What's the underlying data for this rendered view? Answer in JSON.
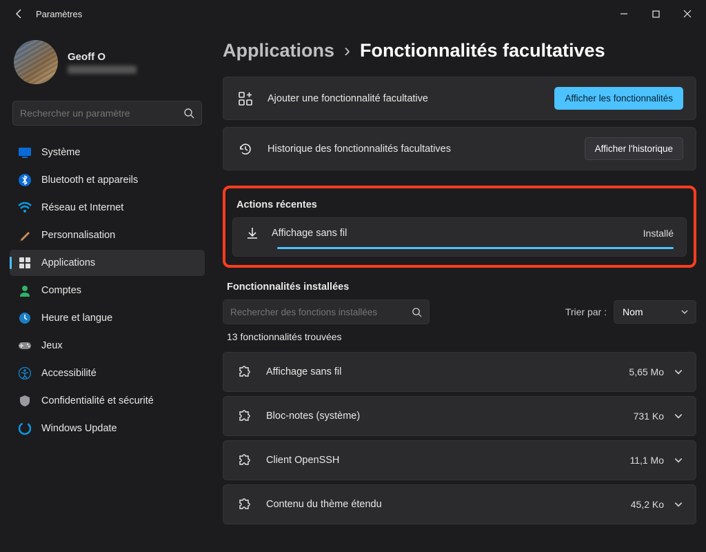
{
  "titlebar": {
    "title": "Paramètres"
  },
  "profile": {
    "name": "Geoff O"
  },
  "search": {
    "placeholder": "Rechercher un paramètre"
  },
  "nav": [
    {
      "id": "system",
      "label": "Système"
    },
    {
      "id": "bluetooth",
      "label": "Bluetooth et appareils"
    },
    {
      "id": "network",
      "label": "Réseau et Internet"
    },
    {
      "id": "personalization",
      "label": "Personnalisation"
    },
    {
      "id": "apps",
      "label": "Applications"
    },
    {
      "id": "accounts",
      "label": "Comptes"
    },
    {
      "id": "time",
      "label": "Heure et langue"
    },
    {
      "id": "gaming",
      "label": "Jeux"
    },
    {
      "id": "accessibility",
      "label": "Accessibilité"
    },
    {
      "id": "privacy",
      "label": "Confidentialité et sécurité"
    },
    {
      "id": "update",
      "label": "Windows Update"
    }
  ],
  "breadcrumb": {
    "parent": "Applications",
    "sep": "›",
    "current": "Fonctionnalités facultatives"
  },
  "topcards": {
    "add": {
      "label": "Ajouter une fonctionnalité facultative",
      "button": "Afficher les fonctionnalités"
    },
    "history": {
      "label": "Historique des fonctionnalités facultatives",
      "button": "Afficher l'historique"
    }
  },
  "recent": {
    "heading": "Actions récentes",
    "item": {
      "label": "Affichage sans fil",
      "status": "Installé"
    }
  },
  "installed": {
    "heading": "Fonctionnalités installées",
    "search_placeholder": "Rechercher des fonctions installées",
    "sort_label": "Trier par :",
    "sort_value": "Nom",
    "count_text": "13 fonctionnalités trouvées",
    "features": [
      {
        "label": "Affichage sans fil",
        "size": "5,65 Mo"
      },
      {
        "label": "Bloc-notes (système)",
        "size": "731 Ko"
      },
      {
        "label": "Client OpenSSH",
        "size": "11,1 Mo"
      },
      {
        "label": "Contenu du thème étendu",
        "size": "45,2 Ko"
      }
    ]
  }
}
